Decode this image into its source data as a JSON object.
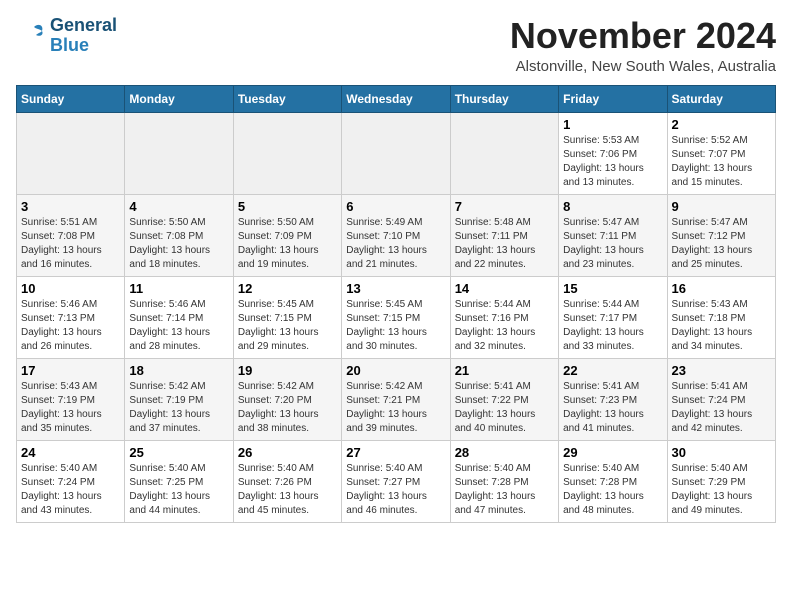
{
  "logo": {
    "line1": "General",
    "line2": "Blue"
  },
  "title": "November 2024",
  "subtitle": "Alstonville, New South Wales, Australia",
  "days_of_week": [
    "Sunday",
    "Monday",
    "Tuesday",
    "Wednesday",
    "Thursday",
    "Friday",
    "Saturday"
  ],
  "weeks": [
    [
      {
        "day": "",
        "info": ""
      },
      {
        "day": "",
        "info": ""
      },
      {
        "day": "",
        "info": ""
      },
      {
        "day": "",
        "info": ""
      },
      {
        "day": "",
        "info": ""
      },
      {
        "day": "1",
        "info": "Sunrise: 5:53 AM\nSunset: 7:06 PM\nDaylight: 13 hours and 13 minutes."
      },
      {
        "day": "2",
        "info": "Sunrise: 5:52 AM\nSunset: 7:07 PM\nDaylight: 13 hours and 15 minutes."
      }
    ],
    [
      {
        "day": "3",
        "info": "Sunrise: 5:51 AM\nSunset: 7:08 PM\nDaylight: 13 hours and 16 minutes."
      },
      {
        "day": "4",
        "info": "Sunrise: 5:50 AM\nSunset: 7:08 PM\nDaylight: 13 hours and 18 minutes."
      },
      {
        "day": "5",
        "info": "Sunrise: 5:50 AM\nSunset: 7:09 PM\nDaylight: 13 hours and 19 minutes."
      },
      {
        "day": "6",
        "info": "Sunrise: 5:49 AM\nSunset: 7:10 PM\nDaylight: 13 hours and 21 minutes."
      },
      {
        "day": "7",
        "info": "Sunrise: 5:48 AM\nSunset: 7:11 PM\nDaylight: 13 hours and 22 minutes."
      },
      {
        "day": "8",
        "info": "Sunrise: 5:47 AM\nSunset: 7:11 PM\nDaylight: 13 hours and 23 minutes."
      },
      {
        "day": "9",
        "info": "Sunrise: 5:47 AM\nSunset: 7:12 PM\nDaylight: 13 hours and 25 minutes."
      }
    ],
    [
      {
        "day": "10",
        "info": "Sunrise: 5:46 AM\nSunset: 7:13 PM\nDaylight: 13 hours and 26 minutes."
      },
      {
        "day": "11",
        "info": "Sunrise: 5:46 AM\nSunset: 7:14 PM\nDaylight: 13 hours and 28 minutes."
      },
      {
        "day": "12",
        "info": "Sunrise: 5:45 AM\nSunset: 7:15 PM\nDaylight: 13 hours and 29 minutes."
      },
      {
        "day": "13",
        "info": "Sunrise: 5:45 AM\nSunset: 7:15 PM\nDaylight: 13 hours and 30 minutes."
      },
      {
        "day": "14",
        "info": "Sunrise: 5:44 AM\nSunset: 7:16 PM\nDaylight: 13 hours and 32 minutes."
      },
      {
        "day": "15",
        "info": "Sunrise: 5:44 AM\nSunset: 7:17 PM\nDaylight: 13 hours and 33 minutes."
      },
      {
        "day": "16",
        "info": "Sunrise: 5:43 AM\nSunset: 7:18 PM\nDaylight: 13 hours and 34 minutes."
      }
    ],
    [
      {
        "day": "17",
        "info": "Sunrise: 5:43 AM\nSunset: 7:19 PM\nDaylight: 13 hours and 35 minutes."
      },
      {
        "day": "18",
        "info": "Sunrise: 5:42 AM\nSunset: 7:19 PM\nDaylight: 13 hours and 37 minutes."
      },
      {
        "day": "19",
        "info": "Sunrise: 5:42 AM\nSunset: 7:20 PM\nDaylight: 13 hours and 38 minutes."
      },
      {
        "day": "20",
        "info": "Sunrise: 5:42 AM\nSunset: 7:21 PM\nDaylight: 13 hours and 39 minutes."
      },
      {
        "day": "21",
        "info": "Sunrise: 5:41 AM\nSunset: 7:22 PM\nDaylight: 13 hours and 40 minutes."
      },
      {
        "day": "22",
        "info": "Sunrise: 5:41 AM\nSunset: 7:23 PM\nDaylight: 13 hours and 41 minutes."
      },
      {
        "day": "23",
        "info": "Sunrise: 5:41 AM\nSunset: 7:24 PM\nDaylight: 13 hours and 42 minutes."
      }
    ],
    [
      {
        "day": "24",
        "info": "Sunrise: 5:40 AM\nSunset: 7:24 PM\nDaylight: 13 hours and 43 minutes."
      },
      {
        "day": "25",
        "info": "Sunrise: 5:40 AM\nSunset: 7:25 PM\nDaylight: 13 hours and 44 minutes."
      },
      {
        "day": "26",
        "info": "Sunrise: 5:40 AM\nSunset: 7:26 PM\nDaylight: 13 hours and 45 minutes."
      },
      {
        "day": "27",
        "info": "Sunrise: 5:40 AM\nSunset: 7:27 PM\nDaylight: 13 hours and 46 minutes."
      },
      {
        "day": "28",
        "info": "Sunrise: 5:40 AM\nSunset: 7:28 PM\nDaylight: 13 hours and 47 minutes."
      },
      {
        "day": "29",
        "info": "Sunrise: 5:40 AM\nSunset: 7:28 PM\nDaylight: 13 hours and 48 minutes."
      },
      {
        "day": "30",
        "info": "Sunrise: 5:40 AM\nSunset: 7:29 PM\nDaylight: 13 hours and 49 minutes."
      }
    ]
  ]
}
